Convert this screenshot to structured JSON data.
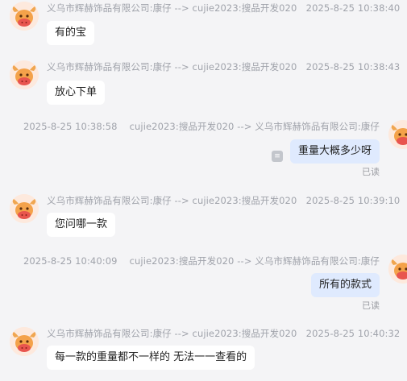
{
  "messages": [
    {
      "direction": "in",
      "sender": "义乌市辉赫饰品有限公司:康仔 --> cujie2023:搜品开发020",
      "time": "2025-8-25 10:38:40",
      "text": "有的宝"
    },
    {
      "direction": "in",
      "sender": "义乌市辉赫饰品有限公司:康仔 --> cujie2023:搜品开发020",
      "time": "2025-8-25 10:38:43",
      "text": "放心下单"
    },
    {
      "direction": "out",
      "sender": "cujie2023:搜品开发020 --> 义乌市辉赫饰品有限公司:康仔",
      "time": "2025-8-25 10:38:58",
      "text": "重量大概多少呀",
      "status": "已读"
    },
    {
      "direction": "in",
      "sender": "义乌市辉赫饰品有限公司:康仔 --> cujie2023:搜品开发020",
      "time": "2025-8-25 10:39:10",
      "text": "您问哪一款"
    },
    {
      "direction": "out",
      "sender": "cujie2023:搜品开发020 --> 义乌市辉赫饰品有限公司:康仔",
      "time": "2025-8-25 10:40:09",
      "text": "所有的款式",
      "status": "已读"
    },
    {
      "direction": "in",
      "sender": "义乌市辉赫饰品有限公司:康仔 --> cujie2023:搜品开发020",
      "time": "2025-8-25 10:40:32",
      "text": "每一款的重量都不一样的 无法一一查看的"
    }
  ],
  "icons": {
    "avatar": "cartoon-cow-avatar-icon",
    "flag": "info-flag-icon"
  },
  "colors": {
    "outgoing_bubble": "#dfeafe",
    "incoming_bubble": "#ffffff",
    "background": "#f4f4f6",
    "meta_text": "#a0a3ab"
  }
}
